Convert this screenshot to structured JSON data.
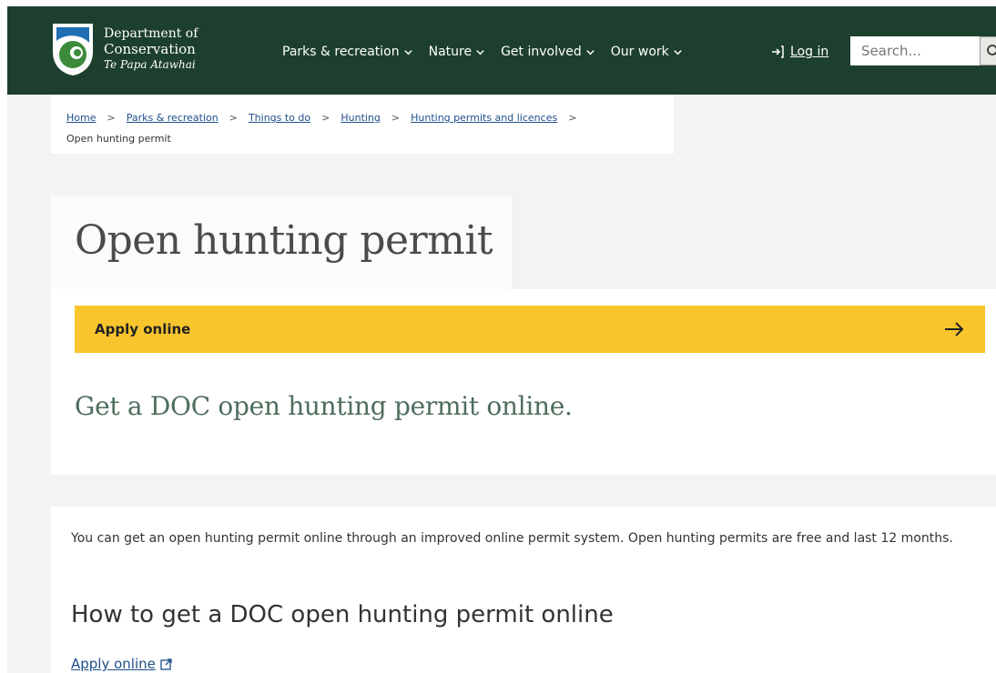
{
  "header": {
    "logo": {
      "line1": "Department of",
      "line2": "Conservation",
      "line3": "Te Papa Atawhai"
    },
    "nav": [
      {
        "label": "Parks & recreation"
      },
      {
        "label": "Nature"
      },
      {
        "label": "Get involved"
      },
      {
        "label": "Our work"
      }
    ],
    "login_label": "Log in",
    "search_placeholder": "Search..."
  },
  "breadcrumb": {
    "links": [
      "Home",
      "Parks & recreation",
      "Things to do",
      "Hunting",
      "Hunting permits and licences"
    ],
    "current": "Open hunting permit"
  },
  "page": {
    "title": "Open hunting permit",
    "cta_label": "Apply online",
    "lede": "Get a DOC open hunting permit online.",
    "intro": "You can get an open hunting permit online through an improved online permit system. Open hunting permits are free and last 12 months.",
    "section_heading": "How to get a DOC open hunting permit online",
    "apply_link": "Apply online"
  },
  "colors": {
    "header_bg": "#1d3f2e",
    "cta_bg": "#f8c52c",
    "link": "#1f4e8a",
    "lede": "#4f6e5c"
  },
  "icons": {
    "logo": "doc-koru-shield-icon",
    "nav_dropdown": "chevron-down-icon",
    "login": "login-arrow-icon",
    "search": "search-icon",
    "cta": "arrow-right-icon",
    "external": "external-link-icon"
  }
}
